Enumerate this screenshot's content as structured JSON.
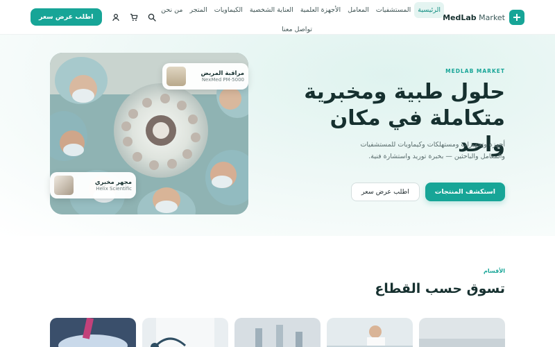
{
  "header": {
    "logo_bold": "MedLab",
    "logo_light": " Market",
    "nav": [
      "الرئيسية",
      "المستشفيات",
      "المعامل",
      "الأجهزة العلمية",
      "العناية الشخصية",
      "الكيماويات",
      "المتجر",
      "من نحن"
    ],
    "nav_row2": "تواصل معنا",
    "quote_button": "اطلب عرض سعر",
    "icons": [
      "search-icon",
      "cart-icon",
      "user-icon"
    ]
  },
  "hero": {
    "eyebrow": "MEDLAB MARKET",
    "title_line1": "حلول طبية ومخبرية",
    "title_line2": "متكاملة في مكان واحد",
    "description": "أجهزة وتجهيزات ومستهلكات وكيماويات للمستشفيات والمعامل والباحثين — بخبرة توريد واستشارة فنية.",
    "primary_button": "استكشف المنتجات",
    "secondary_button": "اطلب عرض سعر",
    "card_a": {
      "title": "مراقبة المريض",
      "subtitle": "NexMed PM-5000"
    },
    "card_b": {
      "title": "مجهر مخبري",
      "subtitle": "Helix Scientific"
    }
  },
  "categories": {
    "eyebrow": "الأقسام",
    "title": "تسوق حسب القطاع"
  },
  "colors": {
    "accent": "#17a597",
    "heading": "#16302f",
    "active_nav_bg": "#e4f4f1"
  }
}
